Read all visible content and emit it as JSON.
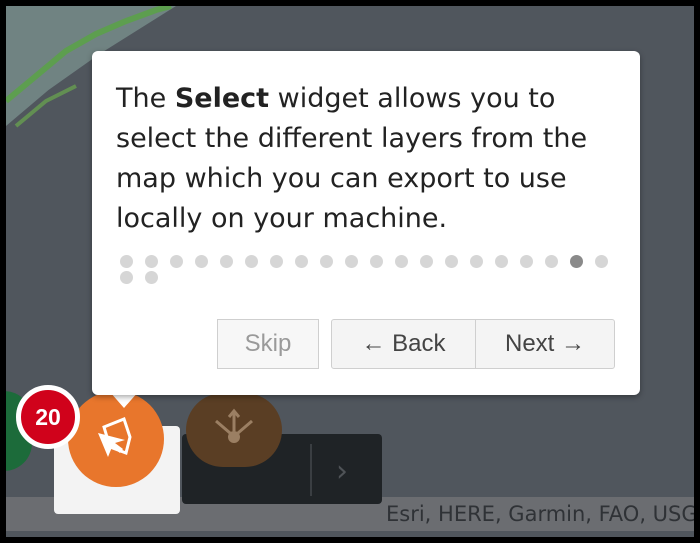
{
  "map": {
    "attribution": "Esri, HERE, Garmin, FAO, USGS, NGA, EPA, NPS | Ho"
  },
  "tour": {
    "text_prefix": "The ",
    "text_bold": "Select",
    "text_suffix": " widget allows you to select the different layers from the map which you can export to use locally on your machine.",
    "total_steps": 22,
    "current_step": 20,
    "buttons": {
      "skip": "Skip",
      "back": "← Back",
      "next": "Next →"
    }
  },
  "widget_bar": {
    "step_badge": "20",
    "select_icon": "select-layers-icon",
    "extract_icon": "extract-data-icon",
    "expand_icon": "chevron-right-icon"
  },
  "colors": {
    "badge": "#d0021b",
    "select_widget": "#e8762c",
    "extract_widget": "#5a3e24",
    "dot_active": "#8a8a8a",
    "dot_inactive": "#d6d6d6"
  }
}
